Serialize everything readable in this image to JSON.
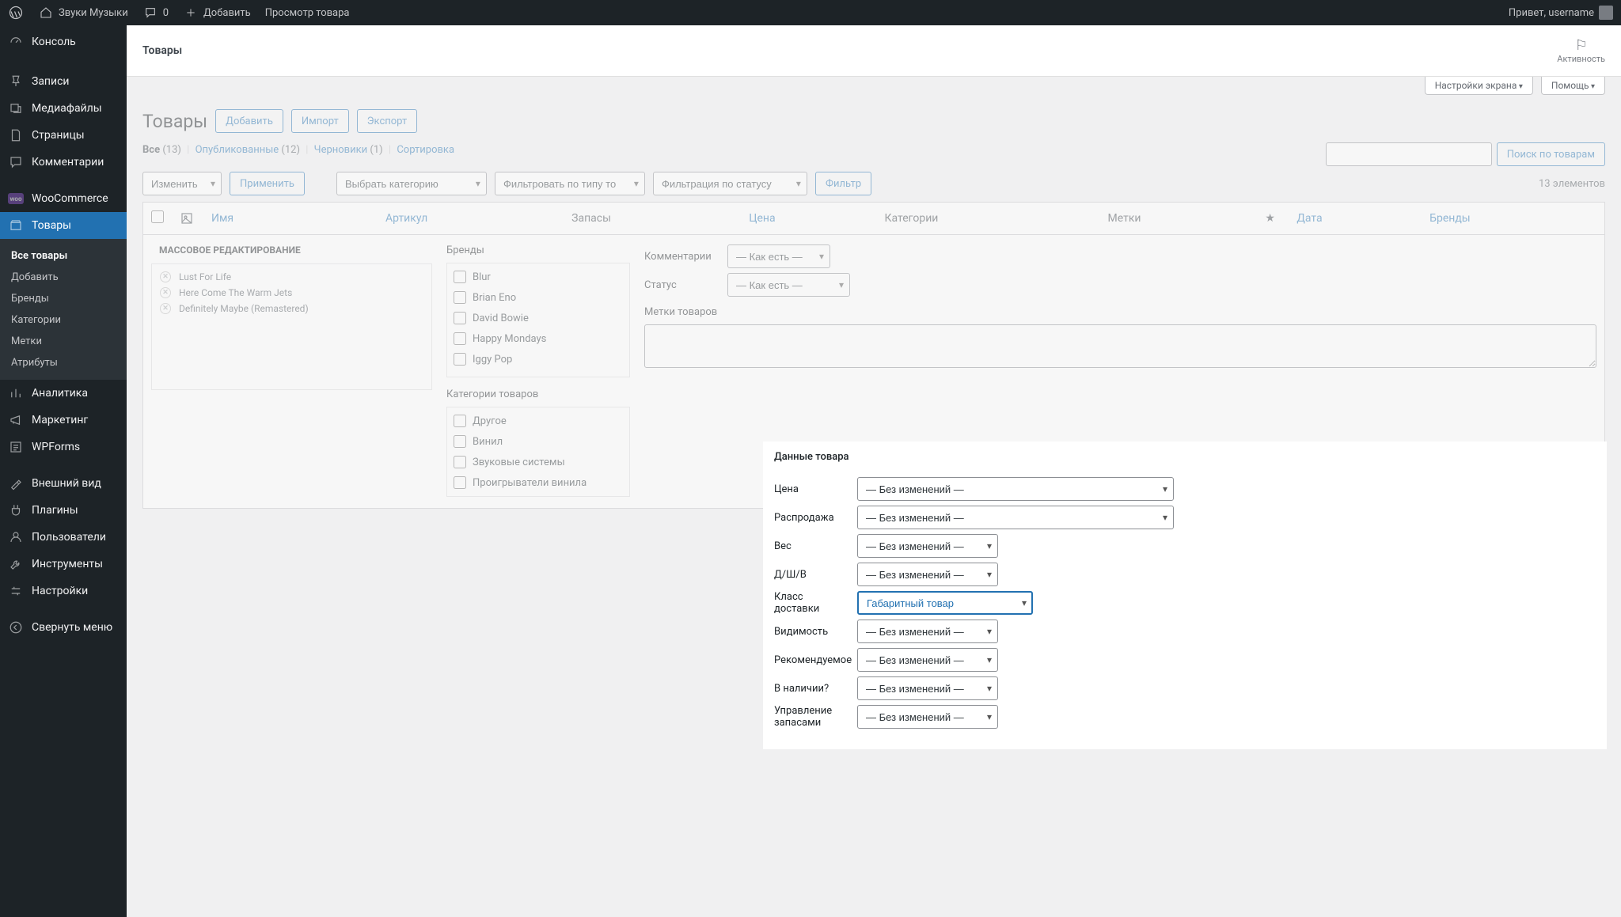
{
  "topbar": {
    "site_name": "Звуки Музыки",
    "comments_count": "0",
    "add_label": "Добавить",
    "view_label": "Просмотр товара",
    "howdy": "Привет, username"
  },
  "sidebar": {
    "console": "Консоль",
    "posts": "Записи",
    "media": "Медиафайлы",
    "pages": "Страницы",
    "comments": "Комментарии",
    "woocommerce": "WooCommerce",
    "products": "Товары",
    "submenu": {
      "all": "Все товары",
      "add": "Добавить",
      "brands": "Бренды",
      "categories": "Категории",
      "tags": "Метки",
      "attributes": "Атрибуты"
    },
    "analytics": "Аналитика",
    "marketing": "Маркетинг",
    "wpforms": "WPForms",
    "appearance": "Внешний вид",
    "plugins": "Плагины",
    "users": "Пользователи",
    "tools": "Инструменты",
    "settings": "Настройки",
    "collapse": "Свернуть меню"
  },
  "header_secondary": {
    "title": "Товары",
    "activity": "Активность"
  },
  "screen_meta": {
    "options": "Настройки экрана",
    "help": "Помощь"
  },
  "page": {
    "title": "Товары",
    "add_btn": "Добавить",
    "import_btn": "Импорт",
    "export_btn": "Экспорт",
    "search_btn": "Поиск по товарам"
  },
  "subsubsub": {
    "all_label": "Все",
    "all_count": "(13)",
    "published_label": "Опубликованные",
    "published_count": "(12)",
    "drafts_label": "Черновики",
    "drafts_count": "(1)",
    "sorting": "Сортировка"
  },
  "tablenav": {
    "bulk_action": "Изменить",
    "apply": "Применить",
    "category": "Выбрать категорию",
    "type": "Фильтровать по типу то",
    "status": "Фильтрация по статусу",
    "filter_btn": "Фильтр",
    "items_count": "13 элементов"
  },
  "table": {
    "cols": {
      "name": "Имя",
      "sku": "Артикул",
      "stock": "Запасы",
      "price": "Цена",
      "categories": "Категории",
      "tags": "Метки",
      "date": "Дата",
      "brands": "Бренды"
    }
  },
  "bulk_edit": {
    "title": "МАССОВОЕ РЕДАКТИРОВАНИЕ",
    "selected": [
      "Lust For Life",
      "Here Come The Warm Jets",
      "Definitely Maybe (Remastered)"
    ],
    "brands_label": "Бренды",
    "brands": [
      "Blur",
      "Brian Eno",
      "David Bowie",
      "Happy Mondays",
      "Iggy Pop"
    ],
    "categories_label": "Категории товаров",
    "categories": [
      "Другое",
      "Винил",
      "Звуковые системы",
      "Проигрыватели винила"
    ],
    "comments_label": "Комментарии",
    "comments_value": "— Как есть —",
    "status_label": "Статус",
    "status_value": "— Как есть —",
    "tags_label": "Метки товаров"
  },
  "product_data": {
    "title": "Данные товара",
    "no_change": "— Без изменений —",
    "price_label": "Цена",
    "sale_label": "Распродажа",
    "weight_label": "Вес",
    "lwh_label": "Д/Ш/В",
    "ship_class_label": "Класс доставки",
    "ship_class_value": "Габаритный товар",
    "visibility_label": "Видимость",
    "featured_label": "Рекомендуемое",
    "instock_label": "В наличии?",
    "manage_label": "Управление запасами"
  }
}
